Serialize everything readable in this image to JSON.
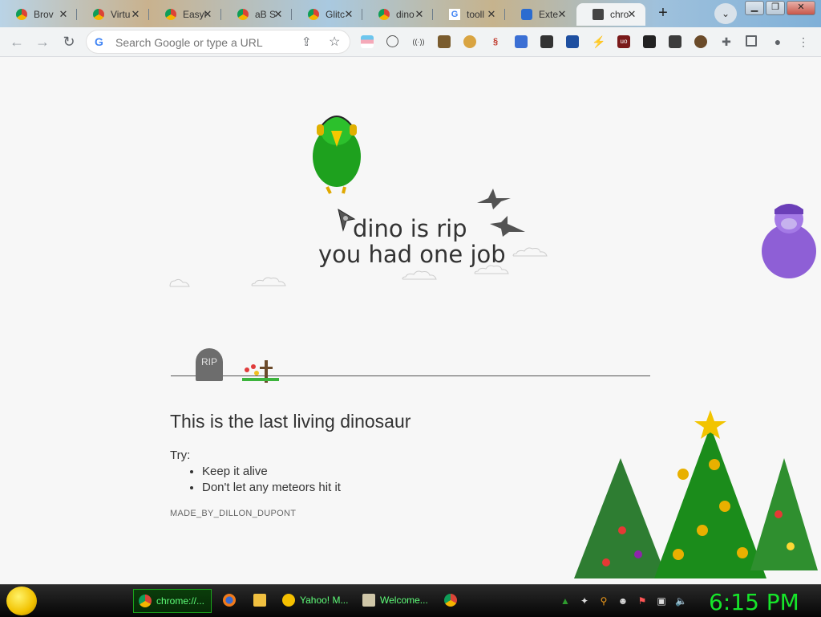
{
  "browser": {
    "tabs": [
      {
        "title": "Brov",
        "icon": "chrome-icon"
      },
      {
        "title": "Virtu",
        "icon": "chrome-icon"
      },
      {
        "title": "Easyl",
        "icon": "chrome-icon"
      },
      {
        "title": "aB S",
        "icon": "chrome-icon"
      },
      {
        "title": "Glitc",
        "icon": "chrome-icon"
      },
      {
        "title": "dino",
        "icon": "chrome-icon"
      },
      {
        "title": "tooll",
        "icon": "google-icon"
      },
      {
        "title": "Exte",
        "icon": "puzzle-icon"
      },
      {
        "title": "chro",
        "icon": "dino-icon",
        "active": true
      }
    ],
    "new_tab": "+",
    "close_glyph": "✕",
    "omnibox": {
      "placeholder": "Search Google or type a URL"
    },
    "window_controls": {
      "minimize": "▁",
      "restore": "❐",
      "close": "✕"
    }
  },
  "page": {
    "messages": [
      "dino is rip",
      "you had one job"
    ],
    "tombstone": "RIP",
    "heading": "This is the last living dinosaur",
    "try_label": "Try:",
    "suggestions": [
      "Keep it alive",
      "Don't let any meteors hit it"
    ],
    "footer": "MADE_BY_DILLON_DUPONT"
  },
  "taskbar": {
    "tasks": [
      {
        "label": "chrome://...",
        "icon": "chrome-icon",
        "active": true
      },
      {
        "label": "",
        "icon": "firefox-icon"
      },
      {
        "label": "",
        "icon": "folder-icon"
      },
      {
        "label": "Yahoo! M...",
        "icon": "yahoo-smiley-icon"
      },
      {
        "label": "Welcome...",
        "icon": "bird-icon"
      },
      {
        "label": "",
        "icon": "chrome-icon"
      }
    ],
    "clock": "6:15 PM"
  },
  "colors": {
    "accent_green": "#16e52a",
    "page_bg": "#f7f7f7",
    "text": "#333333"
  }
}
